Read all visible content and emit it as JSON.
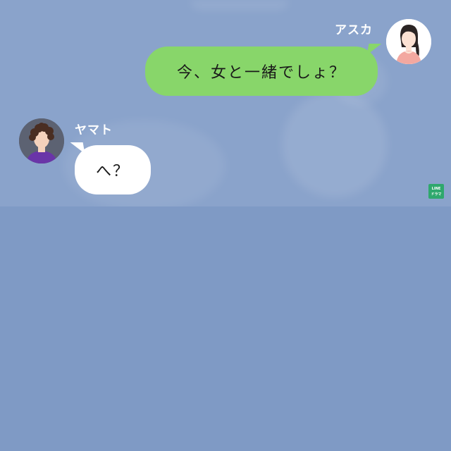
{
  "chat": {
    "messages": [
      {
        "sender": "アスカ",
        "side": "right",
        "text": "今、女と一緒でしょ？",
        "bubble_color": "#88d66a"
      },
      {
        "sender": "ヤマト",
        "side": "left",
        "text": "へ？",
        "bubble_color": "#ffffff"
      }
    ],
    "background_color": "#8aa3cb",
    "lower_background_color": "#7f9ac5"
  },
  "avatars": {
    "right": {
      "icon": "woman-avatar-icon"
    },
    "left": {
      "icon": "curly-hair-man-avatar-icon"
    }
  },
  "brand": {
    "line1": "LINE",
    "line2": "ドラマ",
    "color": "#2fa86d"
  }
}
